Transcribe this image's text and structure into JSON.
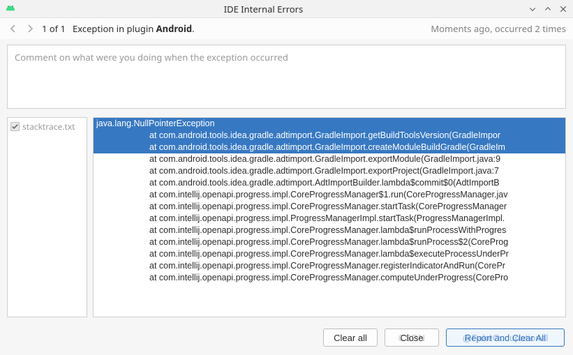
{
  "window": {
    "title": "IDE Internal Errors"
  },
  "nav": {
    "counter": "1 of 1",
    "exception_prefix": "Exception in plugin",
    "exception_plugin": "Android",
    "meta": "Moments ago, occurred 2 times"
  },
  "comment": {
    "placeholder": "Comment on what were you doing when the exception occurred"
  },
  "attachments": {
    "items": [
      {
        "label": "stacktrace.txt",
        "checked": true
      }
    ]
  },
  "stacktrace": {
    "lines": [
      {
        "text": "java.lang.NullPointerException",
        "indent": false,
        "selected": true
      },
      {
        "text": "at com.android.tools.idea.gradle.adtimport.GradleImport.getBuildToolsVersion(GradleImpor",
        "indent": true,
        "selected": true
      },
      {
        "text": "at com.android.tools.idea.gradle.adtimport.GradleImport.createModuleBuildGradle(GradleIm",
        "indent": true,
        "selected": true
      },
      {
        "text": "at com.android.tools.idea.gradle.adtimport.GradleImport.exportModule(GradleImport.java:9",
        "indent": true,
        "selected": false
      },
      {
        "text": "at com.android.tools.idea.gradle.adtimport.GradleImport.exportProject(GradleImport.java:7",
        "indent": true,
        "selected": false
      },
      {
        "text": "at com.android.tools.idea.gradle.adtimport.AdtImportBuilder.lambda$commit$0(AdtImportB",
        "indent": true,
        "selected": false
      },
      {
        "text": "at com.intellij.openapi.progress.impl.CoreProgressManager$1.run(CoreProgressManager.jav",
        "indent": true,
        "selected": false
      },
      {
        "text": "at com.intellij.openapi.progress.impl.CoreProgressManager.startTask(CoreProgressManager",
        "indent": true,
        "selected": false
      },
      {
        "text": "at com.intellij.openapi.progress.impl.ProgressManagerImpl.startTask(ProgressManagerImpl.",
        "indent": true,
        "selected": false
      },
      {
        "text": "at com.intellij.openapi.progress.impl.CoreProgressManager.lambda$runProcessWithProgres",
        "indent": true,
        "selected": false
      },
      {
        "text": "at com.intellij.openapi.progress.impl.CoreProgressManager.lambda$runProcess$2(CoreProg",
        "indent": true,
        "selected": false
      },
      {
        "text": "at com.intellij.openapi.progress.impl.CoreProgressManager.lambda$executeProcessUnderPr",
        "indent": true,
        "selected": false
      },
      {
        "text": "at com.intellij.openapi.progress.impl.CoreProgressManager.registerIndicatorAndRun(CorePr",
        "indent": true,
        "selected": false
      },
      {
        "text": "at com.intellij.openapi.progress.impl.CoreProgressManager.computeUnderProgress(CorePro",
        "indent": true,
        "selected": false
      }
    ]
  },
  "footer": {
    "clear_all": "Clear all",
    "close": "Close",
    "primary": "Report and Clear All",
    "watermark1": "CSDN",
    "watermark2": "@FakeOccupational"
  }
}
